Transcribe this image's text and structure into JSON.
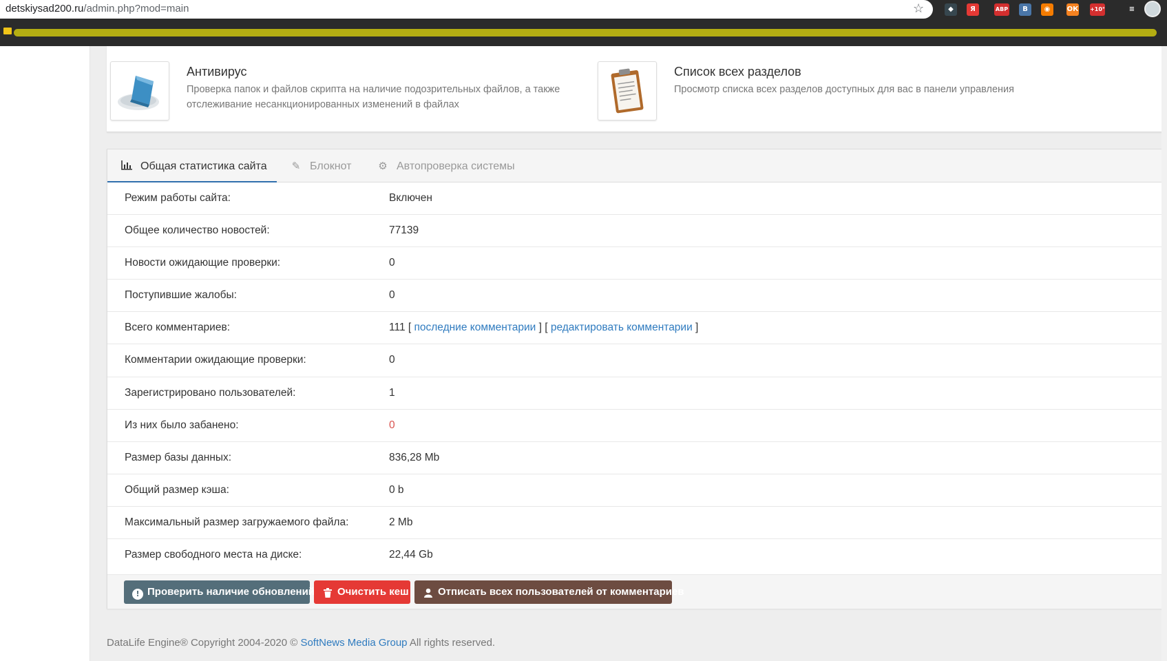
{
  "browser": {
    "url_host": "detskiysad200.ru",
    "url_path": "/admin.php?mod=main",
    "extensions": [
      {
        "name": "ext-1-icon",
        "color": "#37474f",
        "text": "◆"
      },
      {
        "name": "yandex-icon",
        "color": "#e53935",
        "text": "Я"
      },
      {
        "name": "adblock-icon",
        "color": "#d32f2f",
        "text": "ABP"
      },
      {
        "name": "vk-icon",
        "color": "#4a76a8",
        "text": "В"
      },
      {
        "name": "rss-icon",
        "color": "#f57c00",
        "text": "◉"
      },
      {
        "name": "odnoklassniki-icon",
        "color": "#f58220",
        "text": "ОК"
      },
      {
        "name": "weather-icon",
        "color": "#d32f2f",
        "text": "+10°"
      },
      {
        "name": "playlist-icon",
        "color": "#2b2b2b",
        "text": "≡"
      }
    ]
  },
  "shortcuts": [
    {
      "title": "Антивирус",
      "description": "Проверка папок и файлов скрипта на наличие подозрительных файлов, а также отслеживание несанкционированных изменений в файлах"
    },
    {
      "title": "Список всех разделов",
      "description": "Просмотр списка всех разделов доступных для вас в панели управления"
    }
  ],
  "tabs": [
    {
      "label": "Общая статистика сайта",
      "icon": "bar-chart-icon"
    },
    {
      "label": "Блокнот",
      "icon": "edit-icon"
    },
    {
      "label": "Автопроверка системы",
      "icon": "gear-icon"
    }
  ],
  "stats": {
    "site_mode": {
      "label": "Режим работы сайта:",
      "value": "Включен"
    },
    "news_total": {
      "label": "Общее количество новостей:",
      "value": "77139"
    },
    "news_pending": {
      "label": "Новости ожидающие проверки:",
      "value": "0"
    },
    "complaints": {
      "label": "Поступившие жалобы:",
      "value": "0"
    },
    "comments_total": {
      "label": "Всего комментариев:",
      "value": "111",
      "open1": " [ ",
      "link_last": "последние комментарии",
      "sep": " ] [ ",
      "link_edit": "редактировать комментарии",
      "close": " ]"
    },
    "comments_pending": {
      "label": "Комментарии ожидающие проверки:",
      "value": "0"
    },
    "users_registered": {
      "label": "Зарегистрировано пользователей:",
      "value": "1"
    },
    "users_banned": {
      "label": "Из них было забанено:",
      "value": "0"
    },
    "db_size": {
      "label": "Размер базы данных:",
      "value": "836,28 Mb"
    },
    "cache_size": {
      "label": "Общий размер кэша:",
      "value": "0 b"
    },
    "max_upload": {
      "label": "Максимальный размер загружаемого файла:",
      "value": "2 Mb"
    },
    "disk_free": {
      "label": "Размер свободного места на диске:",
      "value": "22,44 Gb"
    }
  },
  "buttons": {
    "check_updates": "Проверить наличие обновлений",
    "clear_cache": "Очистить кеш",
    "unsubscribe_all": "Отписать всех пользователей от комментариев"
  },
  "footer": {
    "prefix": "DataLife Engine® Copyright 2004-2020 © ",
    "company": "SoftNews Media Group",
    "suffix": " All rights reserved."
  },
  "colors": {
    "link": "#2f7bbf",
    "banned_value": "#d9534f",
    "btn_updates": "#546e7a",
    "btn_cache": "#e53935",
    "btn_unsubscribe": "#6d4c41"
  }
}
